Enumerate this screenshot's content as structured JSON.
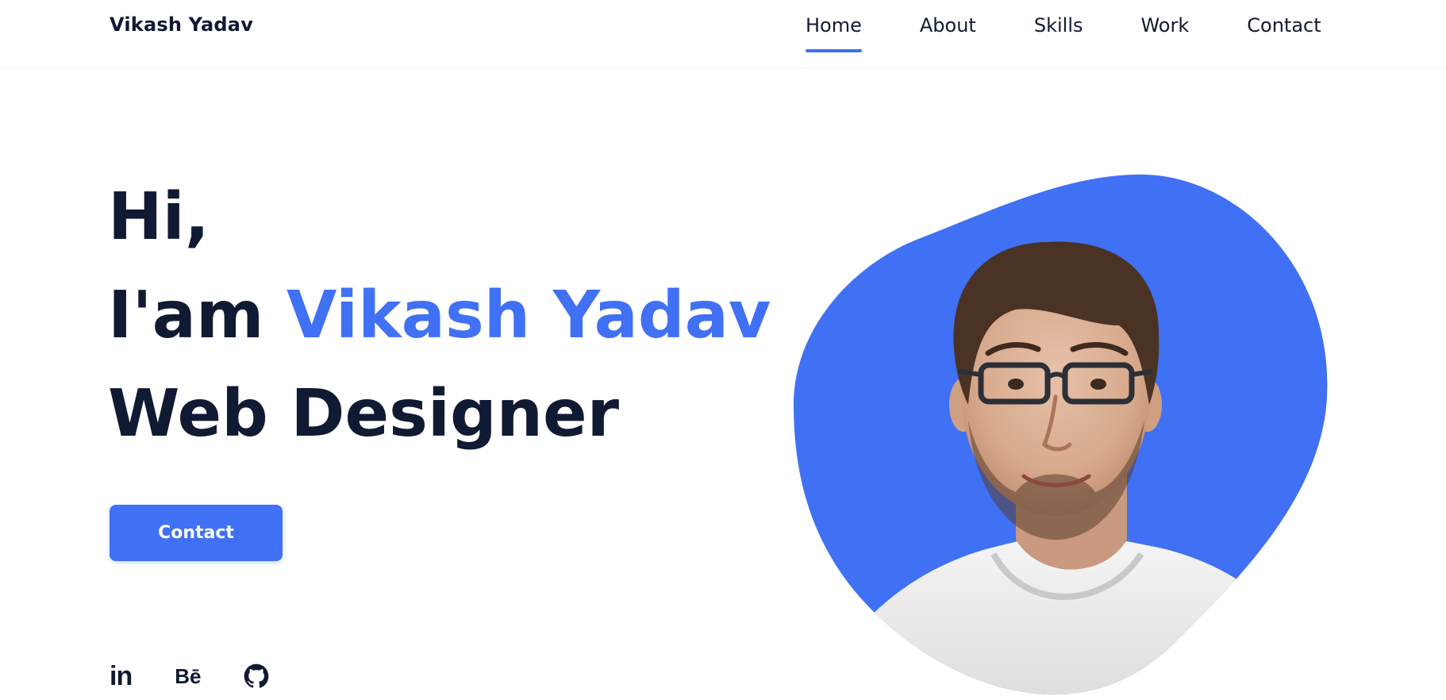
{
  "header": {
    "logo": "Vikash Yadav",
    "nav": [
      {
        "label": "Home",
        "active": true
      },
      {
        "label": "About",
        "active": false
      },
      {
        "label": "Skills",
        "active": false
      },
      {
        "label": "Work",
        "active": false
      },
      {
        "label": "Contact",
        "active": false
      }
    ]
  },
  "hero": {
    "greeting": "Hi,",
    "intro": "I'am",
    "name": "Vikash Yadav",
    "role": "Web Designer",
    "cta_label": "Contact"
  },
  "social": [
    {
      "name": "linkedin",
      "glyph": "in"
    },
    {
      "name": "behance",
      "glyph": "Bē"
    },
    {
      "name": "github",
      "glyph": ""
    }
  ],
  "colors": {
    "accent": "#4070f4",
    "text": "#111a33",
    "background": "#ffffff"
  }
}
